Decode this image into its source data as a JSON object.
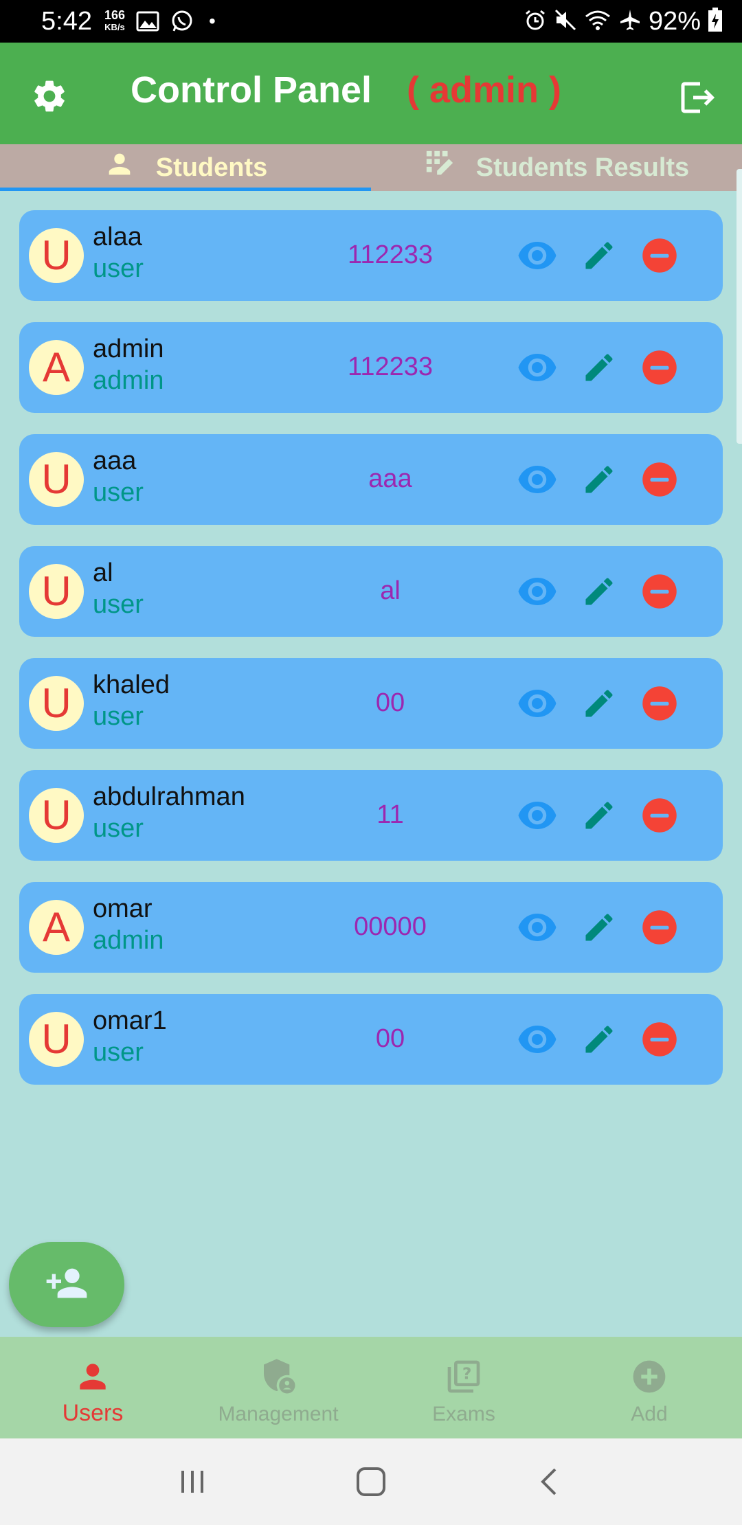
{
  "status_bar": {
    "time": "5:42",
    "speed_value": "166",
    "speed_unit": "KB/s",
    "dot": "•",
    "battery": "92%",
    "icons": [
      "image-icon",
      "whatsapp-icon",
      "alarm-icon",
      "mute-icon",
      "wifi-icon",
      "airplane-icon",
      "battery-icon"
    ]
  },
  "appbar": {
    "title": "Control Panel",
    "role": "( admin )",
    "colors": {
      "background": "#4caf50",
      "role": "#e53935"
    }
  },
  "tabs": [
    {
      "label": "Students",
      "icon": "person-icon",
      "active": true
    },
    {
      "label": "Students Results",
      "icon": "grid-edit-icon",
      "active": false
    }
  ],
  "users": [
    {
      "initial": "U",
      "name": "alaa",
      "role": "user",
      "password": "112233"
    },
    {
      "initial": "A",
      "name": "admin",
      "role": "admin",
      "password": "112233"
    },
    {
      "initial": "U",
      "name": "aaa",
      "role": "user",
      "password": "aaa"
    },
    {
      "initial": "U",
      "name": "al",
      "role": "user",
      "password": "al"
    },
    {
      "initial": "U",
      "name": "khaled",
      "role": "user",
      "password": "00"
    },
    {
      "initial": "U",
      "name": "abdulrahman",
      "role": "user",
      "password": "11"
    },
    {
      "initial": "A",
      "name": "omar",
      "role": "admin",
      "password": "00000"
    },
    {
      "initial": "U",
      "name": "omar1",
      "role": "user",
      "password": "00"
    }
  ],
  "bottom_nav": [
    {
      "label": "Users",
      "icon": "person-icon",
      "active": true
    },
    {
      "label": "Management",
      "icon": "admin-shield-icon",
      "active": false
    },
    {
      "label": "Exams",
      "icon": "quiz-icon",
      "active": false
    },
    {
      "label": "Add",
      "icon": "add-circle-icon",
      "active": false
    }
  ]
}
